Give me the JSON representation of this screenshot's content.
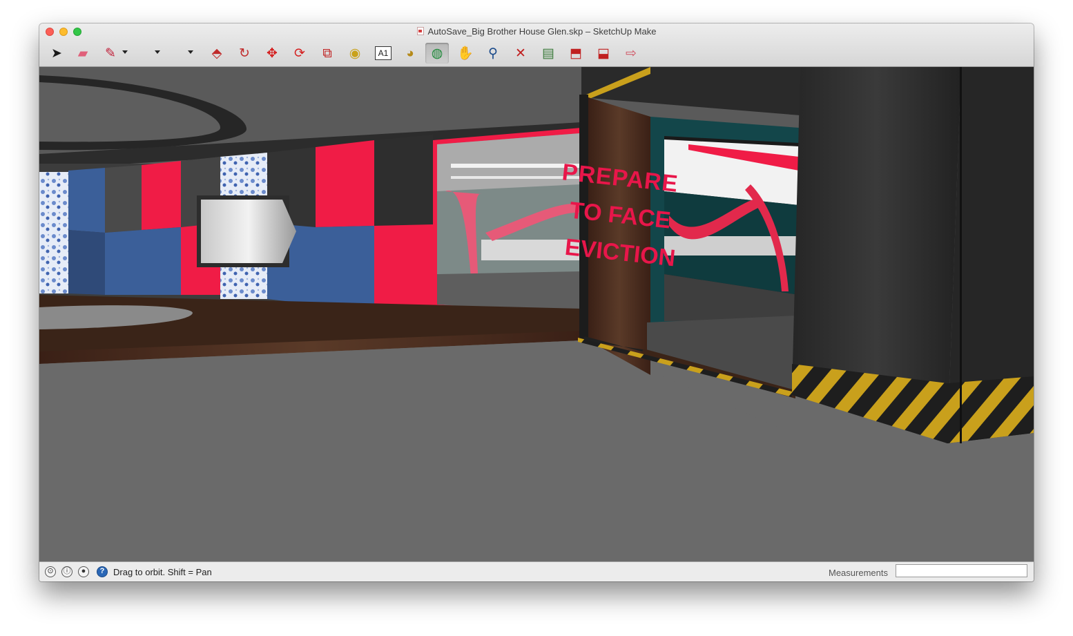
{
  "window": {
    "title": "AutoSave_Big Brother House Glen.skp – SketchUp Make",
    "document_icon": "skp-file-icon"
  },
  "toolbar": {
    "tools": [
      {
        "name": "select-tool",
        "icon": "arrow-cursor-icon",
        "glyph": "➤",
        "color": "#1a1a1a"
      },
      {
        "name": "eraser-tool",
        "icon": "eraser-icon",
        "glyph": "▰",
        "color": "#e0607a"
      },
      {
        "name": "line-tool",
        "icon": "pencil-icon",
        "glyph": "✎",
        "color": "#c0203a"
      },
      {
        "name": "shape-tool",
        "icon": "rectangle-icon",
        "glyph": "",
        "color": "#1a1a1a"
      },
      {
        "name": "arc-tool",
        "icon": "arc-icon",
        "glyph": "",
        "color": "#1a1a1a"
      },
      {
        "name": "push-pull-tool",
        "icon": "push-pull-icon",
        "glyph": "⬘",
        "color": "#c02a2a"
      },
      {
        "name": "follow-me-tool",
        "icon": "follow-me-icon",
        "glyph": "↻",
        "color": "#c02a2a"
      },
      {
        "name": "move-tool",
        "icon": "move-arrows-icon",
        "glyph": "✥",
        "color": "#d42020"
      },
      {
        "name": "rotate-tool",
        "icon": "rotate-icon",
        "glyph": "⟳",
        "color": "#d42020"
      },
      {
        "name": "scale-tool",
        "icon": "scale-icon",
        "glyph": "⧉",
        "color": "#c02020"
      },
      {
        "name": "tape-measure-tool",
        "icon": "tape-measure-icon",
        "glyph": "◉",
        "color": "#c9a21a"
      },
      {
        "name": "text-tool",
        "icon": "text-label-icon",
        "glyph": "A1",
        "color": "#1a1a1a"
      },
      {
        "name": "paint-bucket-tool",
        "icon": "paint-bucket-icon",
        "glyph": "◕",
        "color": "#b58a1a"
      },
      {
        "name": "orbit-tool",
        "icon": "orbit-icon",
        "glyph": "◍",
        "color": "#1f8a3a"
      },
      {
        "name": "pan-tool",
        "icon": "hand-icon",
        "glyph": "✋",
        "color": "#333333"
      },
      {
        "name": "zoom-tool",
        "icon": "magnifier-icon",
        "glyph": "⚲",
        "color": "#1a4a8a"
      },
      {
        "name": "zoom-extents-tool",
        "icon": "zoom-extents-icon",
        "glyph": "✕",
        "color": "#c02020"
      },
      {
        "name": "3d-warehouse-tool",
        "icon": "warehouse-map-icon",
        "glyph": "▤",
        "color": "#3a7a3a"
      },
      {
        "name": "share-model-tool",
        "icon": "share-model-icon",
        "glyph": "⬒",
        "color": "#c02020"
      },
      {
        "name": "components-tool",
        "icon": "extension-warehouse-icon",
        "glyph": "⬓",
        "color": "#c02020"
      },
      {
        "name": "send-to-layout-tool",
        "icon": "layout-icon",
        "glyph": "⇨",
        "color": "#d05060"
      }
    ],
    "active_tool": "orbit-tool"
  },
  "scene": {
    "sign_lines": [
      "PREPARE",
      "TO FACE",
      "EVICTION"
    ],
    "colors": {
      "floor": "#6a6a6a",
      "ceiling": "#585858",
      "wall_dark": "#3c3c3c",
      "wall_red": "#f01c46",
      "wall_blue": "#3b5f99",
      "wood": "#4a2c1c",
      "teal": "#13464a",
      "hazard_yellow": "#e0b020"
    }
  },
  "statusbar": {
    "hint": "Drag to orbit.  Shift = Pan",
    "measurements_label": "Measurements",
    "measurements_value": "",
    "icons": [
      "geo-location-icon",
      "credits-icon",
      "user-icon",
      "help-icon"
    ]
  }
}
